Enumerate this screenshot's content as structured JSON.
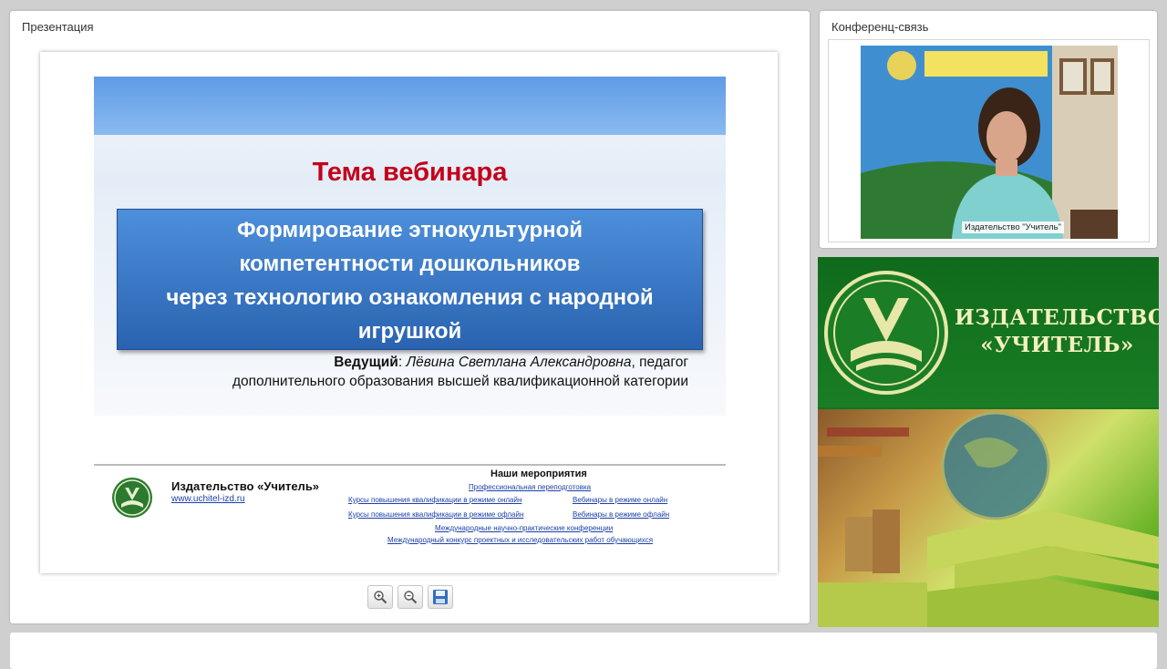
{
  "presentation_panel": {
    "title": "Презентация",
    "slide": {
      "heading": "Тема вебинара",
      "topic_lines": [
        "Формирование этнокультурной",
        "компетентности дошкольников",
        "через технологию ознакомления с народной",
        "игрушкой"
      ],
      "presenter_label": "Ведущий",
      "presenter_name": "Лёвина Светлана Александровна",
      "presenter_role_line1": ", педагог",
      "presenter_role_line2": "дополнительного образования высшей квалификационной категории",
      "footer": {
        "publisher_name": "Издательство «Учитель»",
        "url": "www.uchitel-izd.ru",
        "events_title": "Наши мероприятия",
        "links": {
          "retraining": "Профессиональная переподготовка",
          "courses_online": "Курсы повышения квалификации в режиме онлайн",
          "webinars_online": "Вебинары в режиме онлайн",
          "courses_offline": "Курсы повышения квалификации в режиме офлайн",
          "webinars_offline": "Вебинары в режиме офлайн",
          "conferences": "Международные научно-практические конференции",
          "contest": "Международный конкурс проектных и исследовательских работ обучающихся"
        }
      }
    },
    "toolbar": {
      "zoom_in_icon": "zoom-in-icon",
      "zoom_out_icon": "zoom-out-icon",
      "save_icon": "floppy-disk-icon"
    }
  },
  "conference_panel": {
    "title": "Конференц-связь",
    "video_caption": "Издательство \"Учитель\""
  },
  "banner": {
    "name_line1": "ИЗДАТЕЛЬСТВО",
    "name_line2": "«УЧИТЕЛЬ»"
  },
  "colors": {
    "heading_red": "#c4001b",
    "topic_blue": "#2a63b0",
    "banner_green": "#15741f",
    "link_blue": "#1b3fa8"
  }
}
